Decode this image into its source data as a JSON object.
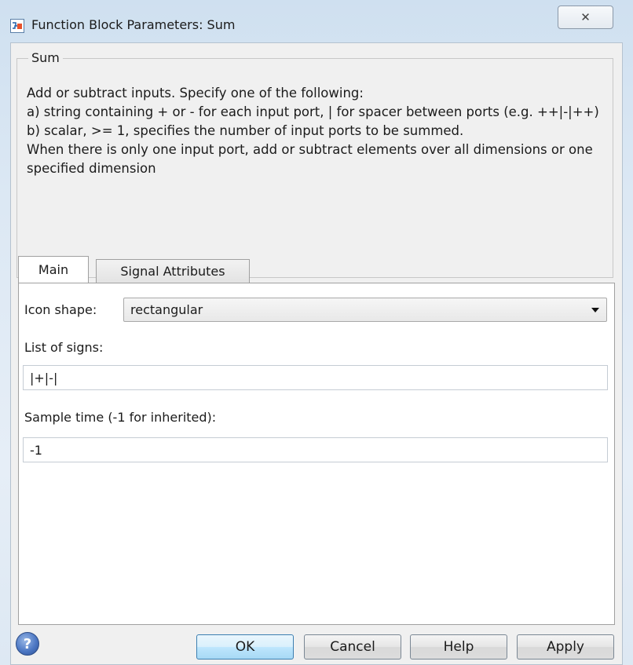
{
  "window": {
    "title": "Function Block Parameters: Sum",
    "close_label": "✕"
  },
  "block": {
    "name": "Sum",
    "description": "Add or subtract inputs.  Specify one of the following:\na) string containing + or - for each input port, | for spacer between ports (e.g. ++|-|++)\nb) scalar, >= 1, specifies the number of input ports to be summed.\nWhen there is only one input port, add or subtract elements over all dimensions or one specified dimension"
  },
  "tabs": [
    {
      "label": "Main",
      "active": true
    },
    {
      "label": "Signal Attributes",
      "active": false
    }
  ],
  "main": {
    "icon_shape_label": "Icon shape:",
    "icon_shape_value": "rectangular",
    "list_of_signs_label": "List of signs:",
    "list_of_signs_value": "|+|-|",
    "sample_time_label": "Sample time (-1 for inherited):",
    "sample_time_value": "-1"
  },
  "buttons": {
    "help_icon": "?",
    "ok": "OK",
    "cancel": "Cancel",
    "help": "Help",
    "apply": "Apply"
  },
  "icons": {
    "app": "simulink-block-icon",
    "help": "help-question-icon",
    "dropdown": "chevron-down-icon"
  }
}
